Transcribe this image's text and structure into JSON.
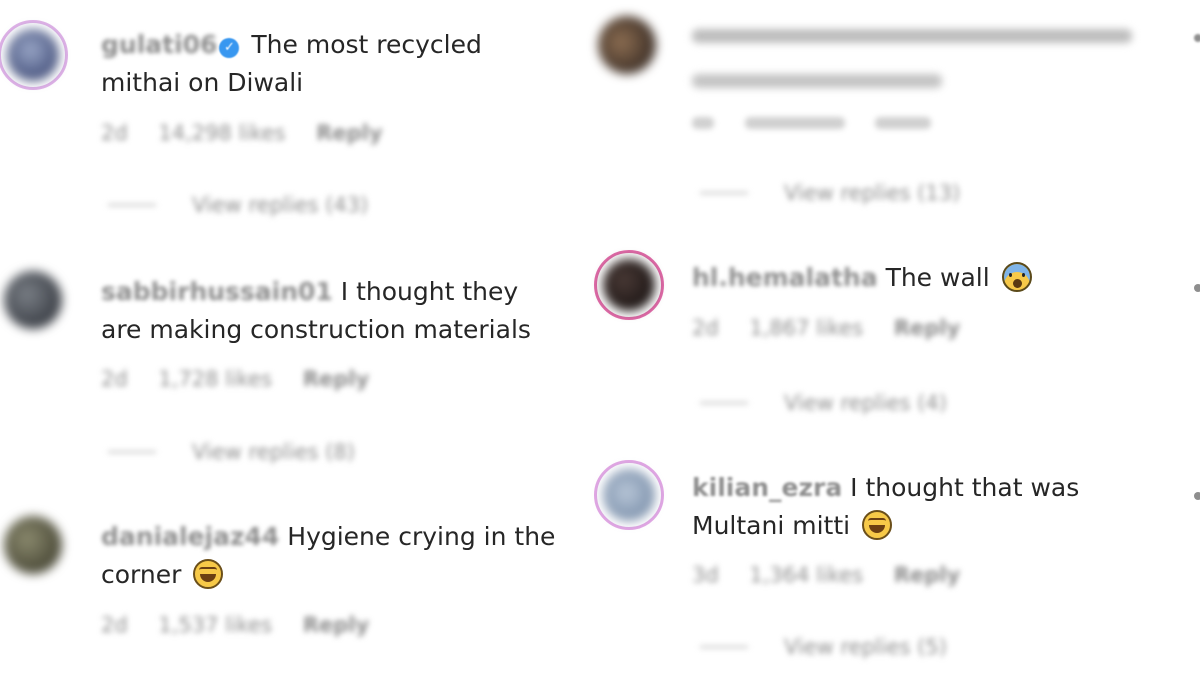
{
  "comments_left": [
    {
      "username": "gulati06",
      "text": "The most recycled mithai on Diwali",
      "time": "2d",
      "likes": "14,298 likes",
      "reply_label": "Reply",
      "view_replies": "View replies (43)"
    },
    {
      "username": "sabbirhussain01",
      "text": "I thought they are making construction materials",
      "time": "2d",
      "likes": "1,728 likes",
      "reply_label": "Reply",
      "view_replies": "View replies (8)"
    },
    {
      "username": "danialejaz44",
      "text": "Hygiene crying in the corner",
      "time": "2d",
      "likes": "1,537 likes",
      "reply_label": "Reply"
    }
  ],
  "comments_right": [
    {
      "username": "",
      "text": "",
      "time": "",
      "likes": "",
      "reply_label": "",
      "view_replies": "View replies (13)"
    },
    {
      "username": "hl.hemalatha",
      "text": "The wall",
      "time": "2d",
      "likes": "1,867 likes",
      "reply_label": "Reply",
      "view_replies": "View replies (4)"
    },
    {
      "username": "kilian_ezra",
      "text": "I thought that was Multani mitti",
      "time": "3d",
      "likes": "1,364 likes",
      "reply_label": "Reply",
      "view_replies": "View replies (5)"
    }
  ],
  "icons": {
    "verified": "verified-badge-icon",
    "laugh": "face-with-tears-of-joy-icon",
    "scream": "face-screaming-icon"
  },
  "colors": {
    "text": "#262626",
    "meta": "#8e8e8e",
    "verified": "#3897f0",
    "story_ring_a": "#d62976",
    "story_ring_b": "#fa7e1e"
  }
}
